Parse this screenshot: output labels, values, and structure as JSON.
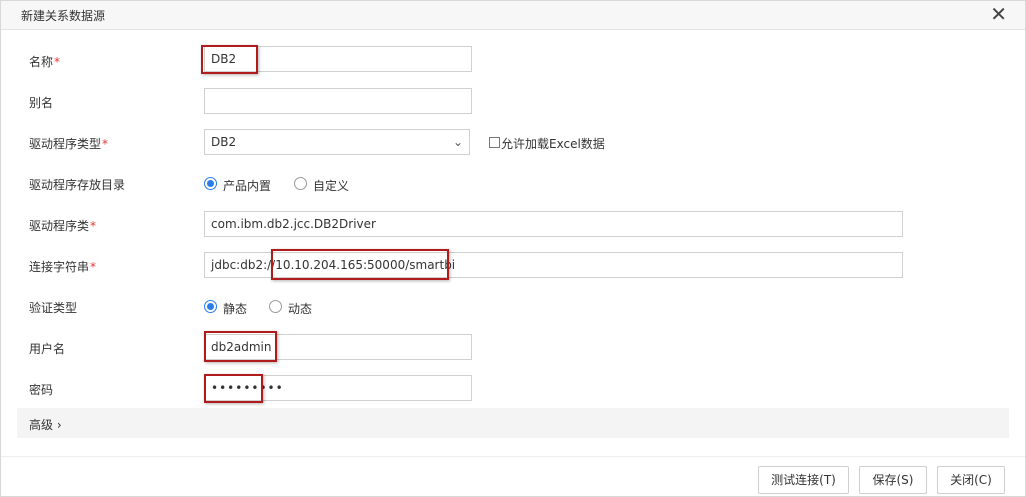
{
  "dialog": {
    "title": "新建关系数据源",
    "close_glyph": "✕"
  },
  "form": {
    "required_mark": "*",
    "name": {
      "label": "名称",
      "value": "DB2"
    },
    "alias": {
      "label": "别名",
      "value": ""
    },
    "driver_type": {
      "label": "驱动程序类型",
      "value": "DB2",
      "arrow": "⌄"
    },
    "allow_excel": {
      "label": "允许加载Excel数据",
      "checked": false
    },
    "driver_dir": {
      "label": "驱动程序存放目录",
      "options": [
        "产品内置",
        "自定义"
      ],
      "selected": "产品内置"
    },
    "driver_class": {
      "label": "驱动程序类",
      "value": "com.ibm.db2.jcc.DB2Driver"
    },
    "conn_string": {
      "label": "连接字符串",
      "value": "jdbc:db2://10.10.204.165:50000/smartbi"
    },
    "auth_type": {
      "label": "验证类型",
      "options": [
        "静态",
        "动态"
      ],
      "selected": "静态"
    },
    "username": {
      "label": "用户名",
      "value": "db2admin"
    },
    "password": {
      "label": "密码",
      "value": "•••••••••"
    }
  },
  "advanced": {
    "label": "高级 ›"
  },
  "buttons": {
    "test": "测试连接(T)",
    "save": "保存(S)",
    "close": "关闭(C)"
  },
  "colors": {
    "accent": "#2b7de9",
    "highlight": "#b01c1c",
    "required": "#e53935"
  }
}
